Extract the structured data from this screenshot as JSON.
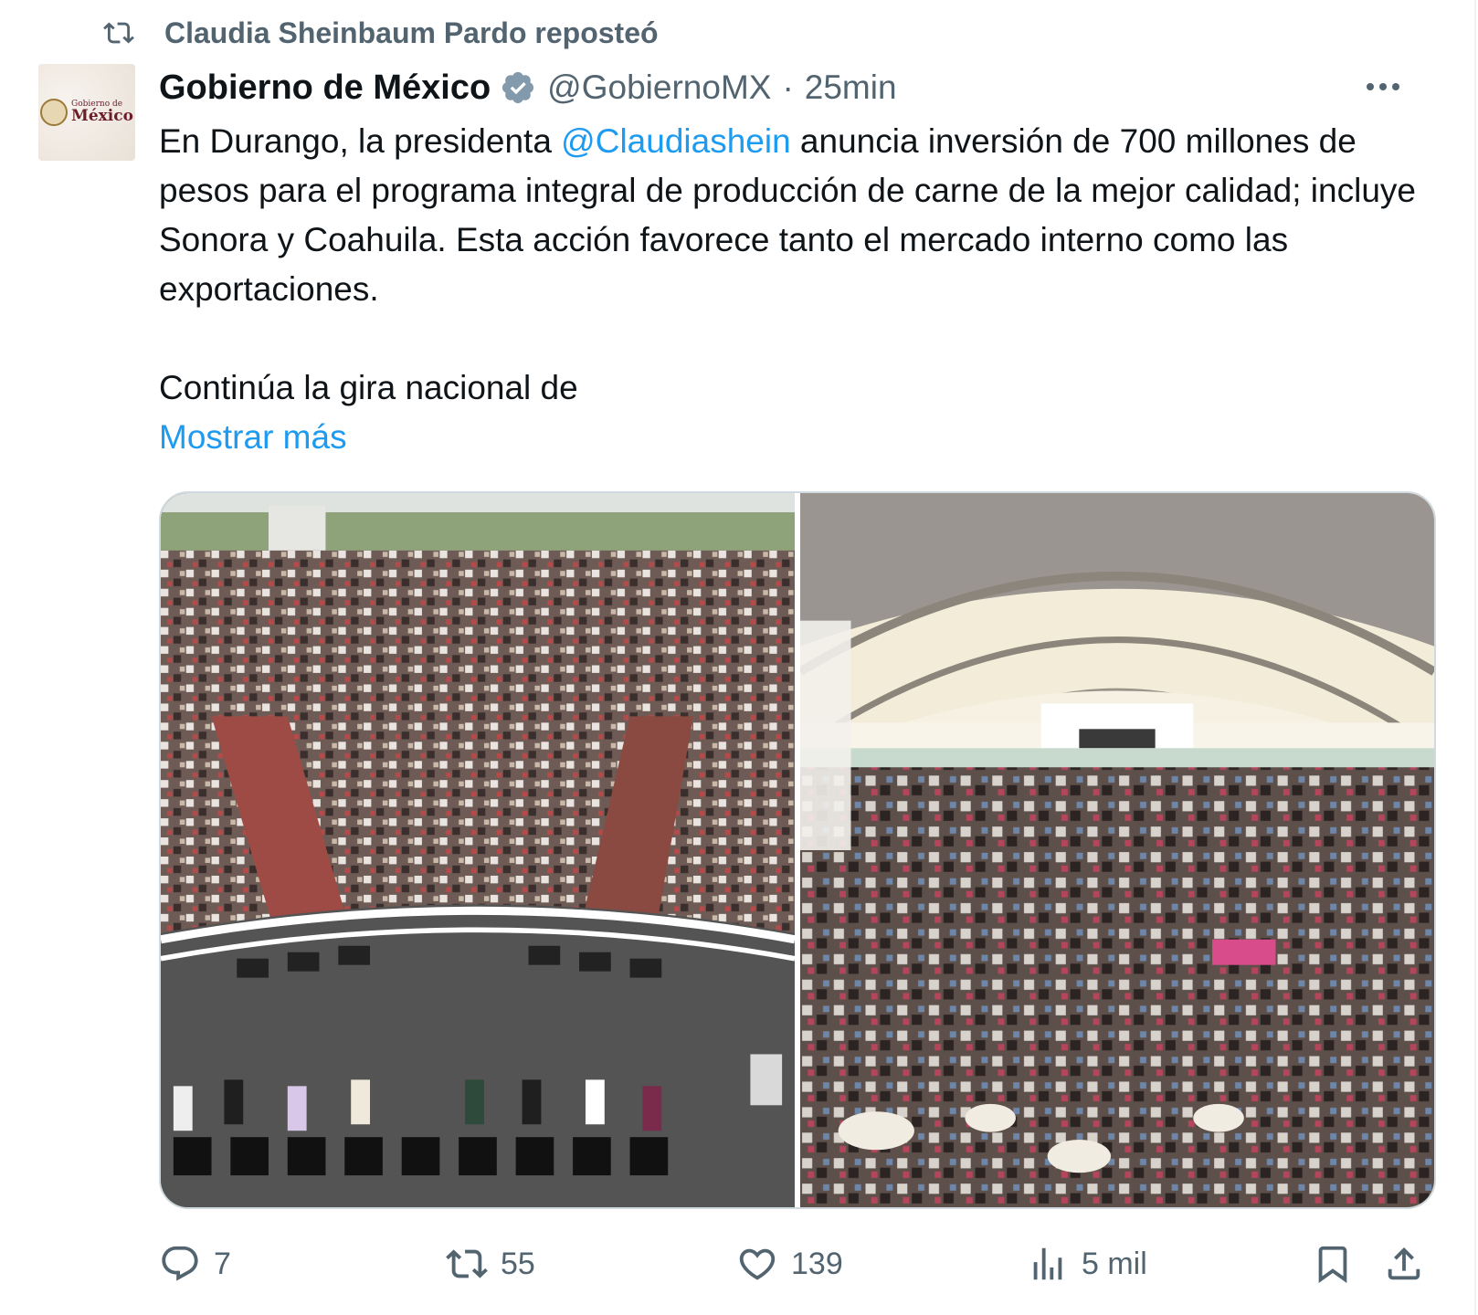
{
  "repost_banner": {
    "text": "Claudia Sheinbaum Pardo reposteó"
  },
  "author": {
    "avatar_small": "Gobierno de",
    "avatar_big": "México",
    "display_name": "Gobierno de México",
    "handle": "@GobiernoMX",
    "separator": "·",
    "time": "25min"
  },
  "tweet": {
    "text_before_mention": "En Durango, la presidenta ",
    "mention": "@Claudiashein",
    "text_after_mention": " anuncia inversión de 700 millones de pesos para el programa integral de producción de carne de la mejor calidad; incluye Sonora y Coahuila. Esta acción favorece tanto el mercado interno como las exportaciones.",
    "second_paragraph": "Continúa la gira nacional de",
    "show_more": "Mostrar más"
  },
  "media": [
    {
      "name": "photo-arena-stage"
    },
    {
      "name": "photo-arena-crowd"
    }
  ],
  "actions": {
    "replies": "7",
    "reposts": "55",
    "likes": "139",
    "views": "5 mil"
  },
  "colors": {
    "accent": "#1d9bf0",
    "secondary_text": "#536471",
    "verified_badge": "#829aab"
  },
  "icons": [
    "repost-icon",
    "verified-badge-icon",
    "more-icon",
    "reply-icon",
    "like-icon",
    "views-icon",
    "bookmark-icon",
    "share-icon"
  ]
}
